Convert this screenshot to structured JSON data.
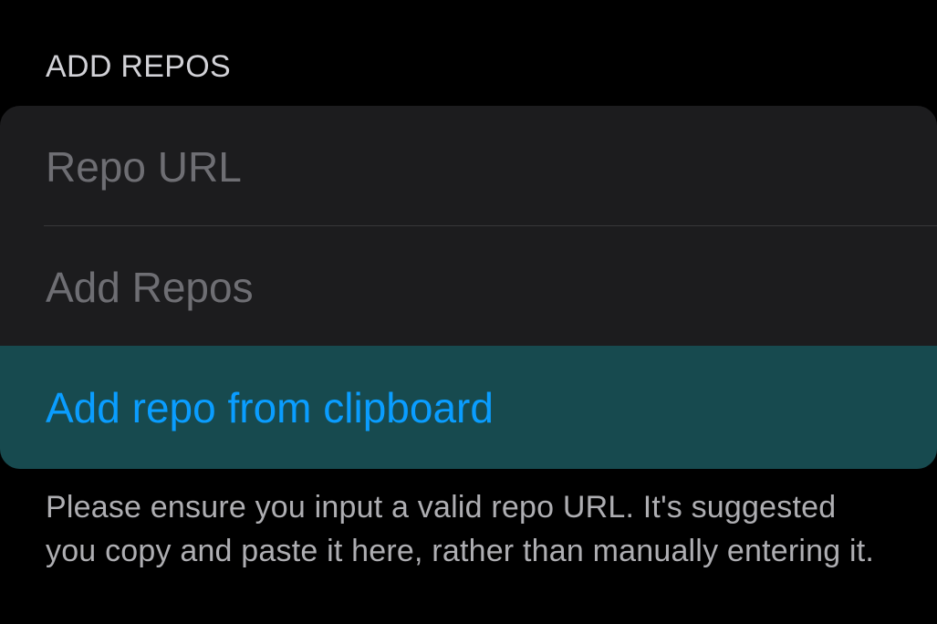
{
  "section": {
    "header": "ADD REPOS"
  },
  "form": {
    "repo_url_placeholder": "Repo URL",
    "add_repos_label": "Add Repos",
    "add_from_clipboard_label": "Add repo from clipboard"
  },
  "footer": {
    "note": "Please ensure you input a valid repo URL. It's suggested you copy and paste it here, rather than manually entering it."
  },
  "colors": {
    "background": "#000000",
    "group_background": "#1c1c1e",
    "highlight_row": "#174a4f",
    "accent_link": "#0a9dff",
    "placeholder_text": "#6e6e73",
    "secondary_text": "#aeaeb2"
  }
}
